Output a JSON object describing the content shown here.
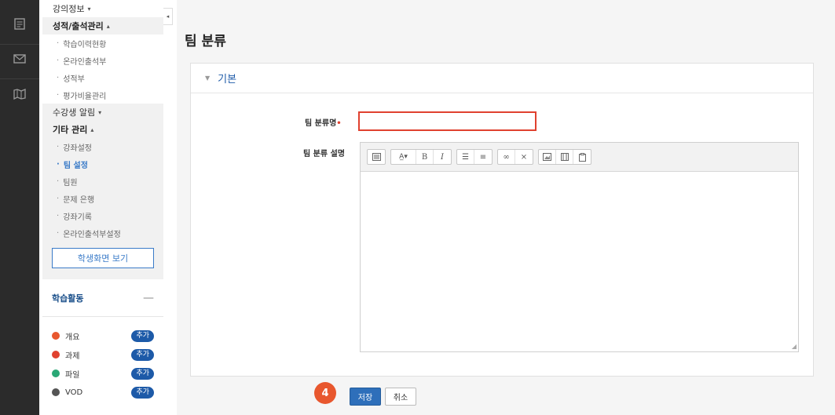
{
  "sidebar": {
    "course_info": "강의정보",
    "grades": {
      "title": "성적/출석관리",
      "items": [
        "학습이력현황",
        "온라인출석부",
        "성적부",
        "평가비율관리"
      ]
    },
    "student_notice": "수강생 알림",
    "etc": {
      "title": "기타 관리",
      "items": [
        "강좌설정",
        "팀 설정",
        "팀원",
        "문제 은행",
        "강좌기록",
        "온라인출석부설정"
      ],
      "active_index": 1
    },
    "student_view_button": "학생화면 보기",
    "activity": {
      "title": "학습활동",
      "collapse": "—",
      "items": [
        {
          "label": "개요",
          "add": "추가",
          "color": "#e8572e"
        },
        {
          "label": "과제",
          "add": "추가",
          "color": "#e0412f"
        },
        {
          "label": "파일",
          "add": "추가",
          "color": "#2aa876"
        },
        {
          "label": "VOD",
          "add": "추가",
          "color": "#555555"
        }
      ]
    }
  },
  "main": {
    "title": "팀 분류",
    "section": "기본",
    "name_label": "팀 분류명",
    "required_mark": "•",
    "desc_label": "팀 분류 설명",
    "name_value": "",
    "step_badge": "4",
    "save": "저장",
    "cancel": "취소"
  },
  "toolbar_icons": [
    "toggle-toolbar-icon",
    "font-size-icon",
    "bold-icon",
    "italic-icon",
    "unordered-list-icon",
    "ordered-list-icon",
    "link-icon",
    "unlink-icon",
    "image-icon",
    "media-icon",
    "paste-icon"
  ],
  "colors": {
    "accent": "#1d5aa8",
    "required": "#e0412f",
    "step": "#e8572e"
  }
}
